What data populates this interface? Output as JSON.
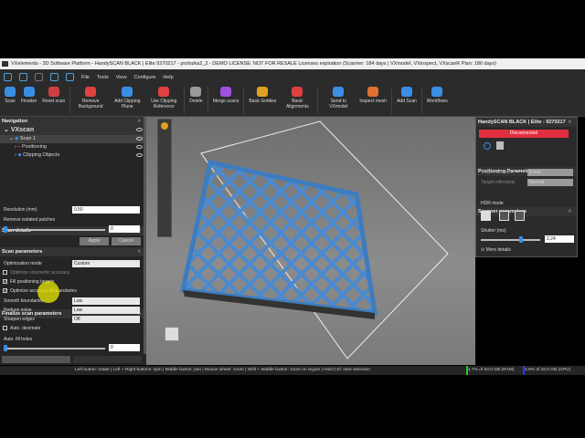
{
  "window": {
    "title": "VXelements - 3D Software Platform - HandySCAN BLACK | Elite 9270217 - prolozka2_2 - DEMO LICENSE: NOT FOR RESALE Licenses expiration (Scanner: 184 days | VXmodel, VXinspect, VXscanR Plan: 186 days)"
  },
  "menu": [
    "File",
    "Tools",
    "View",
    "Configure",
    "Help"
  ],
  "ribbon": [
    {
      "label": "Scan",
      "color": "#3a8ee6"
    },
    {
      "label": "Finalize",
      "color": "#3a8ee6"
    },
    {
      "label": "Reset scan",
      "color": "#d04040"
    },
    {
      "label": "Remove Background",
      "color": "#e04040"
    },
    {
      "label": "Add Clipping Plane",
      "color": "#3a8ee6"
    },
    {
      "label": "Use Clipping Reference",
      "color": "#e04040"
    },
    {
      "label": "Delete",
      "color": "#999"
    },
    {
      "label": "Merge scans",
      "color": "#a050e0"
    },
    {
      "label": "Basic Entities",
      "color": "#e0a020"
    },
    {
      "label": "Basic Alignments",
      "color": "#e04040"
    },
    {
      "label": "Send to VXmodel",
      "color": "#3a8ee6"
    },
    {
      "label": "Inspect mesh",
      "color": "#e07030"
    },
    {
      "label": "Add Scan",
      "color": "#3a8ee6"
    },
    {
      "label": "Workflows",
      "color": "#3a8ee6"
    }
  ],
  "navigation": {
    "title": "Navigation",
    "root": "VXscan",
    "items": [
      "Scan 1",
      "Positioning",
      "Clipping Objects"
    ]
  },
  "scan_details": {
    "title": "Scan details"
  },
  "scan_parameters": {
    "title": "Scan parameters",
    "resolution_label": "Resolution (mm)",
    "resolution": "0.50",
    "patches_label": "Remove isolated patches",
    "patches": "0",
    "apply": "Apply",
    "cancel": "Cancel"
  },
  "finalize": {
    "title": "Finalize scan parameters",
    "mode_label": "Optimization mode",
    "mode": "Custom",
    "opt_vol": "Optimize volumetric accuracy",
    "fill_targets": "Fill positioning targets",
    "opt_bounds": "Optimize accuracy of boundaries",
    "smooth_label": "Smooth boundaries",
    "smooth": "Low",
    "noise_label": "Reduce noise",
    "noise": "Low",
    "sharpen_label": "Sharpen edges",
    "sharpen": "Off",
    "decimate": "Auto. decimate",
    "fill_holes_label": "Auto. fill holes",
    "fill_holes": "0"
  },
  "scanner": {
    "title": "HandySCAN BLACK | Elite - 9270217",
    "status": "Disconnected",
    "status_color": "#e03040",
    "pos_title": "Positioning Parameters",
    "target_diameter_label": "Target diameter",
    "target_diameter": "6 mm",
    "target_refl_label": "Target reflectivity",
    "target_refl": "Normal",
    "params_title": "Scanner parameters",
    "hdr_label": "HDR mode",
    "shutter_label": "Shutter (ms)",
    "shutter": "2.24",
    "more": "More details"
  },
  "status": {
    "hints": "Left button: rotate  |  Left + Right buttons: spin  |  Middle button: pan  |  Mouse wheel: zoom  |  Shift + Middle button: zoom on region  |  Hold Ctrl: start selection",
    "ram": "1.7% of 64.0 GB (RAM)",
    "gpu": "3.6% of 16.0 GB (GPU)"
  }
}
